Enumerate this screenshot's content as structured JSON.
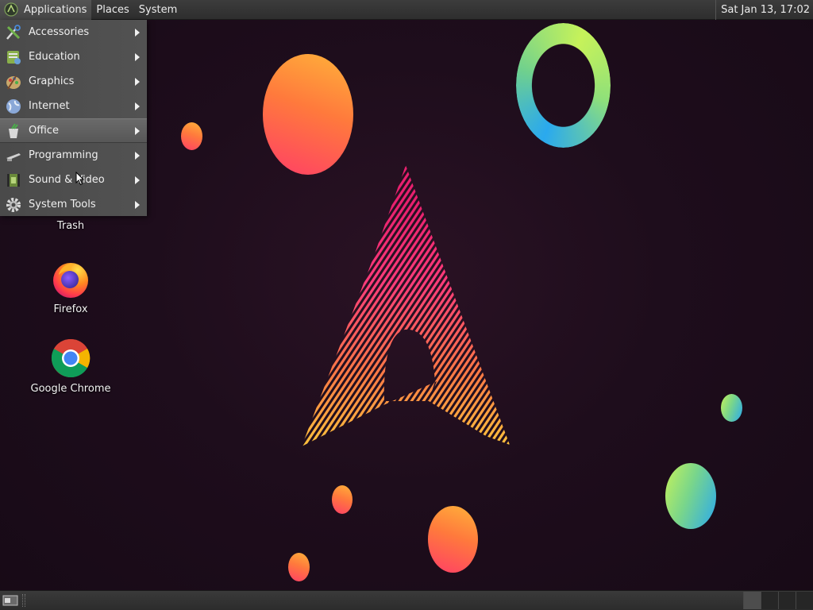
{
  "top_panel": {
    "menus": [
      {
        "label": "Applications",
        "active": true
      },
      {
        "label": "Places",
        "active": false
      },
      {
        "label": "System",
        "active": false
      }
    ],
    "clock": "Sat Jan 13, 17:02"
  },
  "app_menu": {
    "items": [
      {
        "label": "Accessories",
        "icon": "accessories-icon"
      },
      {
        "label": "Education",
        "icon": "education-icon"
      },
      {
        "label": "Graphics",
        "icon": "graphics-icon"
      },
      {
        "label": "Internet",
        "icon": "internet-globe-icon"
      },
      {
        "label": "Office",
        "icon": "office-icon",
        "highlighted": true
      },
      {
        "label": "Programming",
        "icon": "programming-icon"
      },
      {
        "label": "Sound & Video",
        "icon": "sound-video-icon"
      },
      {
        "label": "System Tools",
        "icon": "system-tools-gear-icon"
      }
    ]
  },
  "desktop": {
    "icons": [
      {
        "label": "Trash",
        "icon": "trash-icon"
      },
      {
        "label": "Firefox",
        "icon": "firefox-icon"
      },
      {
        "label": "Google Chrome",
        "icon": "google-chrome-icon"
      }
    ],
    "wallpaper": {
      "logo": "arcolinux-logo",
      "warm_gradient": [
        "#ffb23a",
        "#ff7a3c",
        "#ff3f66"
      ],
      "cool_gradient": [
        "#c6f25a",
        "#7ad68a",
        "#2aa9ee"
      ],
      "background": "#1e0d1c"
    }
  },
  "bottom_panel": {
    "show_desktop_icon": "show-desktop-icon",
    "workspace_count": 4,
    "active_workspace": 1
  }
}
